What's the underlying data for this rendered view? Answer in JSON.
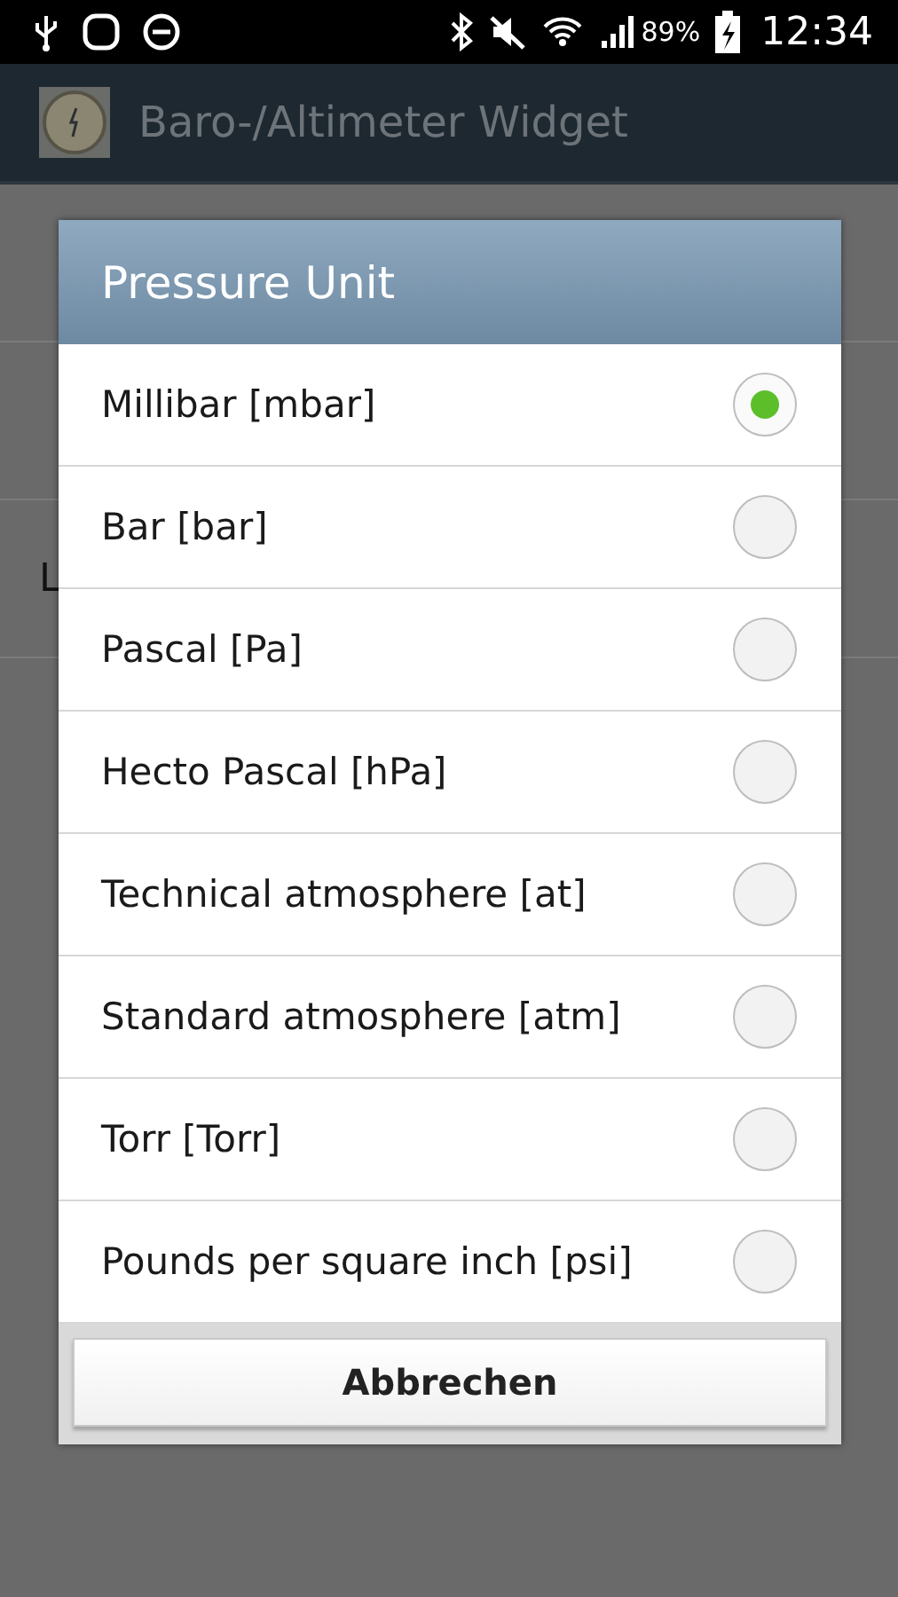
{
  "status_bar": {
    "battery": "89%",
    "time": "12:34"
  },
  "app_bar": {
    "title": "Baro-/Altimeter Widget"
  },
  "background": {
    "rows": [
      {
        "title": "L"
      }
    ]
  },
  "dialog": {
    "title": "Pressure Unit",
    "options": [
      {
        "label": "Millibar [mbar]",
        "selected": true
      },
      {
        "label": "Bar [bar]",
        "selected": false
      },
      {
        "label": "Pascal [Pa]",
        "selected": false
      },
      {
        "label": "Hecto Pascal [hPa]",
        "selected": false
      },
      {
        "label": "Technical atmosphere [at]",
        "selected": false
      },
      {
        "label": "Standard atmosphere [atm]",
        "selected": false
      },
      {
        "label": "Torr [Torr]",
        "selected": false
      },
      {
        "label": "Pounds per square inch [psi]",
        "selected": false
      }
    ],
    "cancel_button": "Abbrechen"
  }
}
